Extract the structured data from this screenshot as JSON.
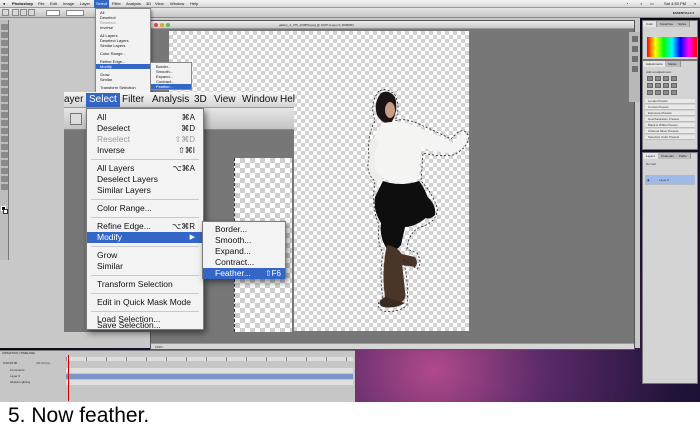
{
  "menubar": {
    "app_name": "Photoshop",
    "items": [
      "File",
      "Edit",
      "Image",
      "Layer",
      "Select",
      "Filter",
      "Analysis",
      "3D",
      "View",
      "Window",
      "Help"
    ],
    "active_item": "Select",
    "clock": "Sat 4:53 PM",
    "accent_color": "#3466c8"
  },
  "workspace": {
    "essentials_label": "ESSENTIALS ▾"
  },
  "document": {
    "title": "gallery_2_375_104853.jpeg @ 100% (Layer 0, RGB/8#)",
    "status": "100%"
  },
  "mini_select_menu": {
    "items": [
      {
        "label": "All",
        "shortcut": "⌘A"
      },
      {
        "label": "Deselect",
        "shortcut": "⌘D"
      },
      {
        "label": "Reselect",
        "shortcut": "⇧⌘D"
      },
      {
        "label": "Inverse",
        "shortcut": "⇧⌘I"
      },
      {
        "label": "All Layers",
        "shortcut": "⌥⌘A"
      },
      {
        "label": "Deselect Layers",
        "shortcut": ""
      },
      {
        "label": "Similar Layers",
        "shortcut": ""
      },
      {
        "label": "Color Range...",
        "shortcut": ""
      },
      {
        "label": "Refine Edge...",
        "shortcut": "⌥⌘R"
      },
      {
        "label": "Modify",
        "shortcut": "▶"
      },
      {
        "label": "Grow",
        "shortcut": ""
      },
      {
        "label": "Similar",
        "shortcut": ""
      },
      {
        "label": "Transform Selection",
        "shortcut": ""
      }
    ],
    "submenu": [
      "Border...",
      "Smooth...",
      "Expand...",
      "Contract...",
      "Feather..."
    ]
  },
  "zoom_menubar": {
    "items": [
      "ayer",
      "Select",
      "Filter",
      "Analysis",
      "3D",
      "View",
      "Window",
      "Hel"
    ],
    "active": "Select"
  },
  "select_menu": {
    "items": [
      {
        "label": "All",
        "shortcut": "⌘A",
        "dim": false
      },
      {
        "label": "Deselect",
        "shortcut": "⌘D",
        "dim": false
      },
      {
        "label": "Reselect",
        "shortcut": "⇧⌘D",
        "dim": true
      },
      {
        "label": "Inverse",
        "shortcut": "⇧⌘I",
        "dim": false
      },
      {
        "label": "All Layers",
        "shortcut": "⌥⌘A",
        "dim": false
      },
      {
        "label": "Deselect Layers",
        "shortcut": "",
        "dim": false
      },
      {
        "label": "Similar Layers",
        "shortcut": "",
        "dim": false
      },
      {
        "label": "Color Range...",
        "shortcut": "",
        "dim": false
      },
      {
        "label": "Refine Edge...",
        "shortcut": "⌥⌘R",
        "dim": false
      },
      {
        "label": "Modify",
        "shortcut": "",
        "dim": false
      },
      {
        "label": "Grow",
        "shortcut": "",
        "dim": false
      },
      {
        "label": "Similar",
        "shortcut": "",
        "dim": false
      },
      {
        "label": "Transform Selection",
        "shortcut": "",
        "dim": false
      },
      {
        "label": "Edit in Quick Mask Mode",
        "shortcut": "",
        "dim": false
      },
      {
        "label": "Load Selection...",
        "shortcut": "",
        "dim": false
      },
      {
        "label": "Save Selection...",
        "shortcut": "",
        "dim": false
      }
    ],
    "highlighted": "Modify"
  },
  "modify_submenu": {
    "items": [
      {
        "label": "Border...",
        "shortcut": ""
      },
      {
        "label": "Smooth...",
        "shortcut": ""
      },
      {
        "label": "Expand...",
        "shortcut": ""
      },
      {
        "label": "Contract...",
        "shortcut": ""
      },
      {
        "label": "Feather...",
        "shortcut": "⇧F6"
      }
    ],
    "highlighted": "Feather..."
  },
  "panels": {
    "color_tabs": [
      "Color",
      "Swatches",
      "Styles"
    ],
    "adjust_tabs": [
      "Adjustments",
      "Masks"
    ],
    "adjust_label": "Add an adjustment",
    "layers_tabs": [
      "Layers",
      "Channels",
      "Paths"
    ],
    "layers_mode": "Normal",
    "layer_name": "Layer 0",
    "preset_rows": [
      "Levels Presets",
      "Curves Presets",
      "Exposure Presets",
      "Hue/Saturation Presets",
      "Black & White Presets",
      "Channel Mixer Presets",
      "Selective Color Presets"
    ]
  },
  "timeline": {
    "title": "ANIMATION (TIMELINE)",
    "timecode": "0:00:00:00",
    "fps": "(30.00 fps)",
    "tracks": [
      "Comments",
      "Layer 0",
      "Global Lighting"
    ]
  },
  "caption": "5. Now feather."
}
